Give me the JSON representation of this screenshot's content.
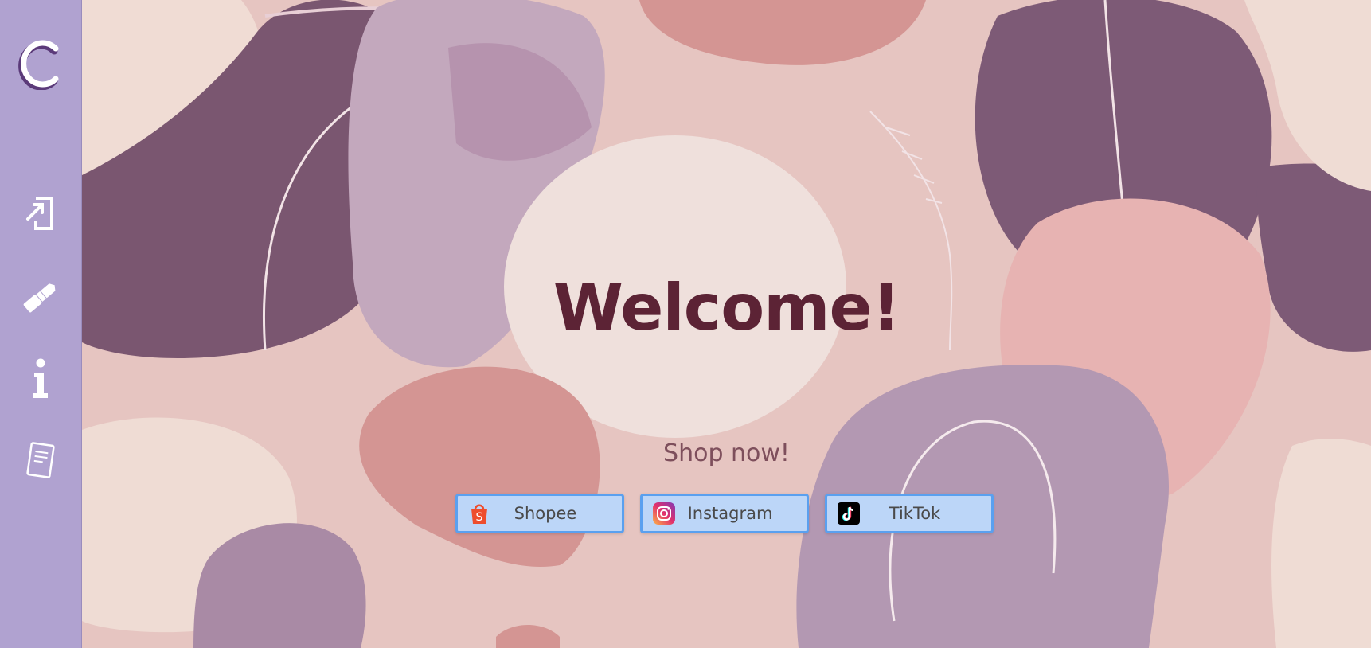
{
  "sidebar": {
    "logo_letter": "C",
    "items": [
      {
        "icon": "login-icon"
      },
      {
        "icon": "lipstick-icon"
      },
      {
        "icon": "info-icon"
      },
      {
        "icon": "document-icon"
      }
    ]
  },
  "main": {
    "heading": "Welcome!",
    "subheading": "Shop now!",
    "buttons": [
      {
        "label": "Shopee",
        "icon": "shopee-icon",
        "icon_color": "#ee4d2d"
      },
      {
        "label": "Instagram",
        "icon": "instagram-icon",
        "icon_color": "#d6249f"
      },
      {
        "label": "TikTok",
        "icon": "tiktok-icon",
        "icon_color": "#000000"
      }
    ]
  },
  "colors": {
    "sidebar": "#b0a2d0",
    "heading": "#5c2335",
    "button_bg": "#bcd6f8",
    "button_border": "#5aa0ef"
  }
}
